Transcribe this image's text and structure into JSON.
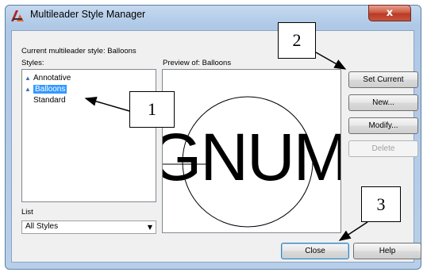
{
  "window": {
    "title": "Multileader Style Manager",
    "close_glyph": "x"
  },
  "current_style": {
    "label": "Current multileader style: Balloons"
  },
  "styles": {
    "label": "Styles:",
    "items": [
      {
        "label": "Annotative",
        "icon": "annotative-icon",
        "selected": false
      },
      {
        "label": "Balloons",
        "icon": "annotative-icon",
        "selected": true
      },
      {
        "label": "Standard",
        "icon": "",
        "selected": false
      }
    ]
  },
  "preview": {
    "label": "Preview of: Balloons",
    "sample_text": "GNUM"
  },
  "list_filter": {
    "label": "List",
    "selected": "All Styles"
  },
  "buttons": {
    "set_current": "Set Current",
    "new": "New...",
    "modify": "Modify...",
    "delete": "Delete",
    "close": "Close",
    "help": "Help"
  },
  "callouts": [
    "1",
    "2",
    "3"
  ],
  "colors": {
    "selection": "#3399ff",
    "title_bar": "#b8cfe9",
    "close_button": "#c9533c"
  }
}
